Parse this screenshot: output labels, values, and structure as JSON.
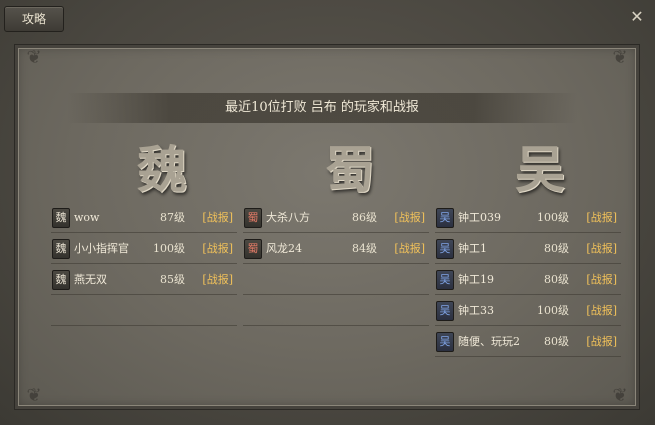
{
  "tab": {
    "label": "攻略"
  },
  "close": {
    "glyph": "✕"
  },
  "header": {
    "title": "最近10位打败 吕布 的玩家和战报"
  },
  "kingdoms": {
    "wei": {
      "name": "魏",
      "badge": "魏"
    },
    "shu": {
      "name": "蜀",
      "badge": "蜀"
    },
    "wu": {
      "name": "吴",
      "badge": "吴"
    }
  },
  "players": {
    "wei": [
      {
        "name": "wow",
        "level": "87级",
        "report": "[战报]"
      },
      {
        "name": "小小指挥官",
        "level": "100级",
        "report": "[战报]"
      },
      {
        "name": "燕无双",
        "level": "85级",
        "report": "[战报]"
      }
    ],
    "shu": [
      {
        "name": "大杀八方",
        "level": "86级",
        "report": "[战报]"
      },
      {
        "name": "风龙24",
        "level": "84级",
        "report": "[战报]"
      }
    ],
    "wu": [
      {
        "name": "钟工039",
        "level": "100级",
        "report": "[战报]"
      },
      {
        "name": "钟工1",
        "level": "80级",
        "report": "[战报]"
      },
      {
        "name": "钟工19",
        "level": "80级",
        "report": "[战报]"
      },
      {
        "name": "钟工33",
        "level": "100级",
        "report": "[战报]"
      },
      {
        "name": "随便、玩玩2",
        "level": "80级",
        "report": "[战报]"
      }
    ]
  }
}
